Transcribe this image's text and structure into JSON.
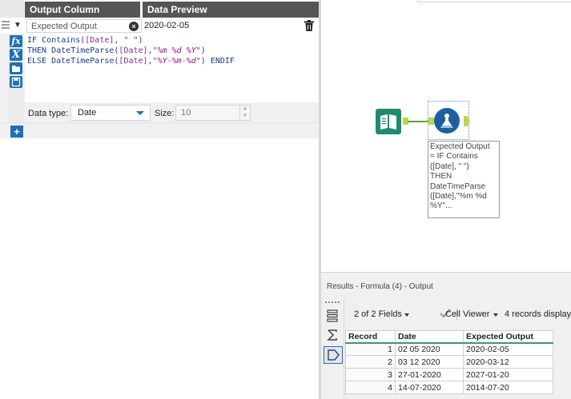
{
  "formula": {
    "headers": {
      "output_column": "Output Column",
      "data_preview": "Data Preview"
    },
    "row": {
      "output_name": "Expected Output",
      "preview": "2020-02-05"
    },
    "expression_lines": [
      [
        {
          "t": "IF ",
          "c": "k"
        },
        {
          "t": "Contains",
          "c": "fn"
        },
        {
          "t": "(",
          "c": "k"
        },
        {
          "t": "[Date]",
          "c": "f"
        },
        {
          "t": ", ",
          "c": "k"
        },
        {
          "t": "\" \"",
          "c": "s"
        },
        {
          "t": ")",
          "c": "k"
        }
      ],
      [
        {
          "t": "THEN ",
          "c": "k"
        },
        {
          "t": "DateTimeParse",
          "c": "fn"
        },
        {
          "t": "(",
          "c": "k"
        },
        {
          "t": "[Date]",
          "c": "f"
        },
        {
          "t": ",",
          "c": "k"
        },
        {
          "t": "\"%m %d %Y\"",
          "c": "s"
        },
        {
          "t": ")",
          "c": "k"
        }
      ],
      [
        {
          "t": "ELSE ",
          "c": "k"
        },
        {
          "t": "DateTimeParse",
          "c": "fn"
        },
        {
          "t": "(",
          "c": "k"
        },
        {
          "t": "[Date]",
          "c": "f"
        },
        {
          "t": ",",
          "c": "k"
        },
        {
          "t": "\"%Y-%m-%d\"",
          "c": "s"
        },
        {
          "t": ") ENDIF",
          "c": "k"
        }
      ]
    ],
    "data_type_label": "Data type:",
    "data_type_value": "Date",
    "size_label": "Size:",
    "size_value": "10",
    "tools": [
      "fx-icon",
      "variable-icon",
      "open-icon",
      "save-icon"
    ]
  },
  "canvas": {
    "annotation": "Expected Output\n= IF Contains\n([Date], \" \")\nTHEN\nDateTimeParse\n([Date],\"%m %d\n%Y\"..."
  },
  "results": {
    "title": "Results - Formula (4) - Output",
    "fields_label": "2 of 2 Fields",
    "viewer_label": "Cell Viewer",
    "records_label": "4 records displaye",
    "columns": [
      "Record",
      "Date",
      "Expected Output"
    ],
    "rows": [
      [
        "1",
        "02 05 2020",
        "2020-02-05"
      ],
      [
        "2",
        "03 12 2020",
        "2020-03-12"
      ],
      [
        "3",
        "27-01-2020",
        "2027-01-20"
      ],
      [
        "4",
        "14-07-2020",
        "2014-07-20"
      ]
    ]
  },
  "colors": {
    "accent": "#1e6fb8",
    "header_dark": "#555555",
    "input_tool": "#1f8a70",
    "anchor": "#b8d94a",
    "wire": "#5aa23a",
    "grid_underline": "#3a9a68"
  }
}
